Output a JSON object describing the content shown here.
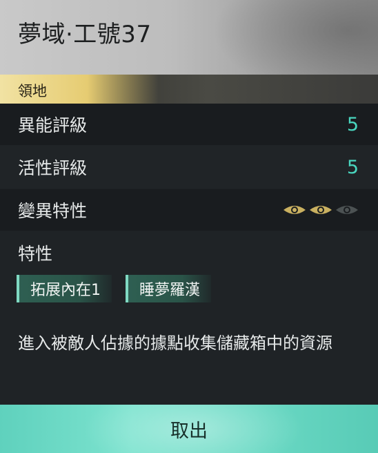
{
  "header": {
    "title": "夢域·工號37"
  },
  "category": {
    "label": "領地"
  },
  "stats": [
    {
      "label": "異能評級",
      "value": "5"
    },
    {
      "label": "活性評級",
      "value": "5"
    },
    {
      "label": "變異特性"
    }
  ],
  "mutation": {
    "filled": 2,
    "total": 3,
    "filled_color": "#c9b060",
    "empty_color": "#4c5253"
  },
  "traits": {
    "title": "特性",
    "tags": [
      "拓展內在1",
      "睡夢羅漢"
    ]
  },
  "description": "進入被敵人佔據的據點收集儲藏箱中的資源",
  "footer": {
    "button_label": "取出"
  },
  "colors": {
    "accent": "#49d6bf",
    "gold": "#e6cc72",
    "footer": "#6cdac5"
  }
}
